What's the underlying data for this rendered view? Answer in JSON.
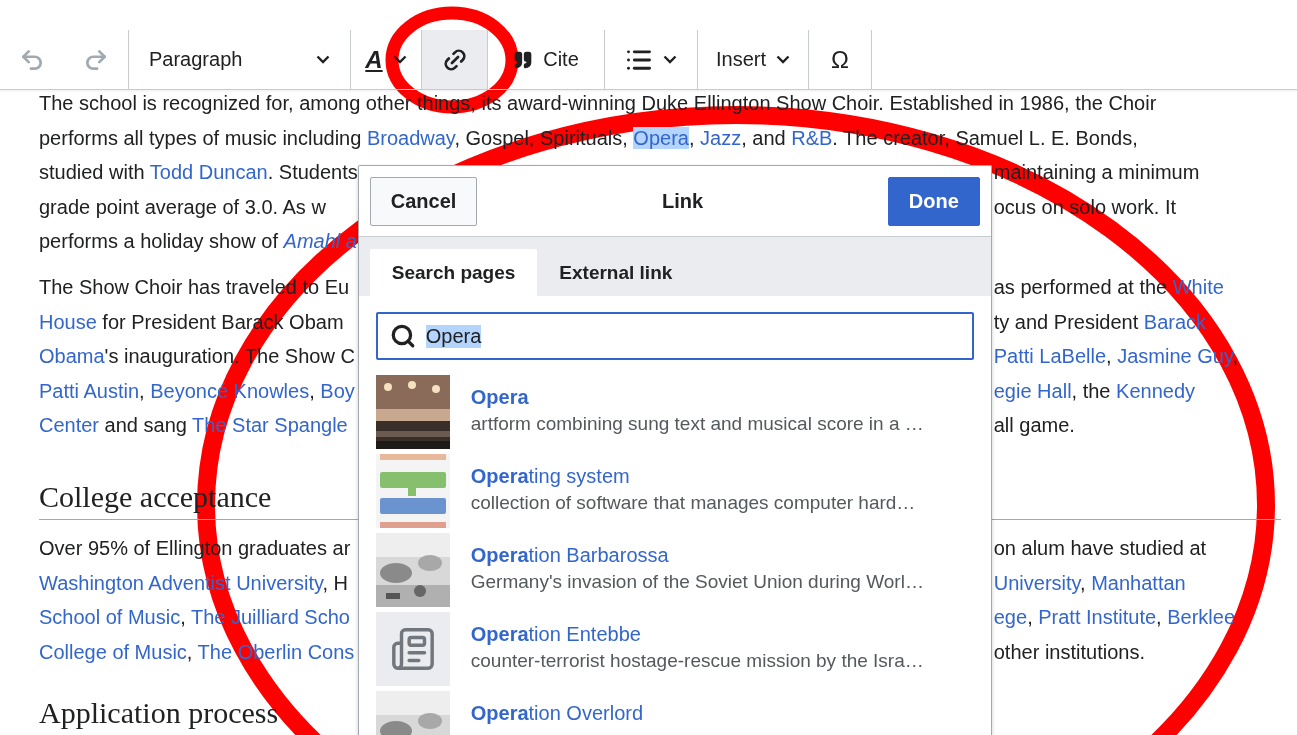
{
  "toolbar": {
    "items": [
      {
        "kind": "undo",
        "active": false,
        "disabled": true
      },
      {
        "kind": "redo",
        "active": false,
        "disabled": true
      },
      {
        "kind": "format",
        "label": "Paragraph",
        "active": false,
        "disabled": false
      },
      {
        "kind": "style",
        "label": "A",
        "active": false,
        "disabled": false
      },
      {
        "kind": "link",
        "active": true,
        "disabled": false
      },
      {
        "kind": "cite",
        "label": "Cite",
        "active": false,
        "disabled": false
      },
      {
        "kind": "list",
        "active": false,
        "disabled": false
      },
      {
        "kind": "menu",
        "label": "Insert",
        "active": false,
        "disabled": false
      },
      {
        "kind": "special",
        "label": "Ω",
        "active": false,
        "disabled": false
      }
    ]
  },
  "article": {
    "intro_lines": [
      [
        {
          "text": "The school is recognized for, among other things, its award-winning Duke Ellington Show Choir. Established in 1986, the Choir",
          "kind": "text"
        }
      ],
      [
        {
          "text": "performs all types of music including ",
          "kind": "text"
        },
        {
          "text": "Broadway",
          "kind": "link"
        },
        {
          "text": ", Gospel, Spirituals, ",
          "kind": "text"
        },
        {
          "text": "Opera",
          "kind": "link",
          "highlighted": true
        },
        {
          "text": ", ",
          "kind": "text"
        },
        {
          "text": "Jazz",
          "kind": "link"
        },
        {
          "text": ", and ",
          "kind": "text"
        },
        {
          "text": "R&B",
          "kind": "link"
        },
        {
          "text": ". The creator, Samuel L. E. Bonds,",
          "kind": "text"
        }
      ]
    ],
    "left_column": [
      {
        "kind": "paragraph",
        "lines": [
          [
            {
              "text": "studied with ",
              "kind": "text"
            },
            {
              "text": "Todd Duncan",
              "kind": "link"
            },
            {
              "text": ". Students",
              "kind": "text"
            }
          ],
          [
            {
              "text": "grade point average of 3.0. As w",
              "kind": "text"
            }
          ],
          [
            {
              "text": "performs a holiday show of ",
              "kind": "text"
            },
            {
              "text": "*Amahl a*",
              "kind": "link"
            }
          ]
        ]
      },
      {
        "kind": "paragraph",
        "lines": [
          [
            {
              "text": "The Show Choir has traveled to Eu",
              "kind": "text"
            }
          ],
          [
            {
              "text": "House",
              "kind": "link"
            },
            {
              "text": " for President Barack Obam",
              "kind": "text"
            }
          ],
          [
            {
              "text": "Obama",
              "kind": "link"
            },
            {
              "text": "'s inauguration. The Show C",
              "kind": "text"
            }
          ],
          [
            {
              "text": "Patti Austin",
              "kind": "link"
            },
            {
              "text": ", ",
              "kind": "text"
            },
            {
              "text": "Beyoncé Knowles",
              "kind": "link"
            },
            {
              "text": ", ",
              "kind": "text"
            },
            {
              "text": "Boy",
              "kind": "link"
            }
          ],
          [
            {
              "text": "Center",
              "kind": "link"
            },
            {
              "text": " and sang ",
              "kind": "text"
            },
            {
              "text": "The Star Spangle",
              "kind": "link"
            }
          ]
        ]
      },
      {
        "kind": "heading",
        "text": "College acceptance"
      },
      {
        "kind": "paragraph",
        "lines": [
          [
            {
              "text": "Over 95% of Ellington graduates ar",
              "kind": "text"
            }
          ],
          [
            {
              "text": "Washington Adventist University",
              "kind": "link"
            },
            {
              "text": ", H",
              "kind": "text"
            }
          ],
          [
            {
              "text": "School of Music",
              "kind": "link"
            },
            {
              "text": ", ",
              "kind": "text"
            },
            {
              "text": "The Juilliard Scho",
              "kind": "link"
            }
          ],
          [
            {
              "text": "College of Music",
              "kind": "link"
            },
            {
              "text": ", ",
              "kind": "text"
            },
            {
              "text": "The Oberlin Cons",
              "kind": "link"
            }
          ]
        ]
      },
      {
        "kind": "heading",
        "text": "Application process"
      }
    ],
    "right_column": [
      {
        "kind": "paragraph",
        "lines": [
          [
            {
              "text": "maintaining a minimum",
              "kind": "text"
            }
          ],
          [
            {
              "text": "ocus on solo work. It",
              "kind": "text"
            }
          ]
        ]
      },
      {
        "kind": "paragraph",
        "lines": [
          [
            {
              "text": "as performed at the ",
              "kind": "text"
            },
            {
              "text": "White",
              "kind": "link"
            }
          ],
          [
            {
              "text": "ty and President ",
              "kind": "text"
            },
            {
              "text": "Barack",
              "kind": "link"
            }
          ],
          [
            {
              "text": "Patti LaBelle",
              "kind": "link"
            },
            {
              "text": ", ",
              "kind": "text"
            },
            {
              "text": "Jasmine Guy",
              "kind": "link"
            },
            {
              "text": ",",
              "kind": "text"
            }
          ],
          [
            {
              "text": "egie Hall",
              "kind": "link"
            },
            {
              "text": ", the ",
              "kind": "text"
            },
            {
              "text": "Kennedy",
              "kind": "link"
            }
          ],
          [
            {
              "text": "all game.",
              "kind": "text"
            }
          ]
        ]
      },
      {
        "kind": "rule"
      },
      {
        "kind": "paragraph",
        "lines": [
          [
            {
              "text": "on alum have studied at",
              "kind": "text"
            }
          ],
          [
            {
              "text": "University",
              "kind": "link"
            },
            {
              "text": ", ",
              "kind": "text"
            },
            {
              "text": "Manhattan",
              "kind": "link"
            }
          ],
          [
            {
              "text": "ege",
              "kind": "link"
            },
            {
              "text": ", ",
              "kind": "text"
            },
            {
              "text": "Pratt Institute",
              "kind": "link"
            },
            {
              "text": ", ",
              "kind": "text"
            },
            {
              "text": "Berklee",
              "kind": "link"
            }
          ],
          [
            {
              "text": "other institutions.",
              "kind": "text"
            }
          ]
        ]
      }
    ]
  },
  "link_dialog": {
    "cancel": "Cancel",
    "title": "Link",
    "done": "Done",
    "tabs": [
      {
        "label": "Search pages",
        "selected": true
      },
      {
        "label": "External link",
        "selected": false
      }
    ],
    "search": {
      "value": "Opera",
      "value_selected": true
    },
    "results": [
      {
        "title": "**Opera**",
        "description": "artform combining sung text and musical score in a …",
        "kind": "picture"
      },
      {
        "title": "**Opera**ting system",
        "description": "collection of software that manages computer hard…",
        "kind": "picture"
      },
      {
        "title": "**Opera**tion Barbarossa",
        "description": "Germany's invasion of the Soviet Union during Worl…",
        "kind": "picture"
      },
      {
        "title": "**Opera**tion Entebbe",
        "description": "counter-terrorist hostage-rescue mission by the Isra…",
        "kind": "icon"
      },
      {
        "title": "**Opera**tion Overlord",
        "kind": "picture"
      }
    ]
  },
  "annotations": [
    {
      "kind": "ring"
    },
    {
      "kind": "ring"
    }
  ]
}
